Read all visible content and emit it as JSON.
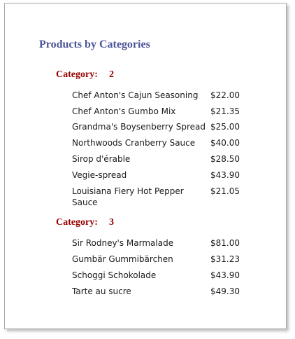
{
  "report": {
    "title": "Products by Categories",
    "groups": [
      {
        "category_label": "Category:",
        "category_value": "2",
        "products": [
          {
            "name": "Chef Anton's Cajun Seasoning",
            "price": "$22.00"
          },
          {
            "name": "Chef Anton's Gumbo Mix",
            "price": "$21.35"
          },
          {
            "name": "Grandma's Boysenberry Spread",
            "price": "$25.00"
          },
          {
            "name": "Northwoods Cranberry Sauce",
            "price": "$40.00"
          },
          {
            "name": "Sirop d'érable",
            "price": "$28.50"
          },
          {
            "name": "Vegie-spread",
            "price": "$43.90"
          },
          {
            "name": "Louisiana Fiery Hot Pepper Sauce",
            "price": "$21.05"
          }
        ]
      },
      {
        "category_label": "Category:",
        "category_value": "3",
        "products": [
          {
            "name": "Sir Rodney's Marmalade",
            "price": "$81.00"
          },
          {
            "name": "Gumbär Gummibärchen",
            "price": "$31.23"
          },
          {
            "name": "Schoggi Schokolade",
            "price": "$43.90"
          },
          {
            "name": "Tarte au sucre",
            "price": "$49.30"
          }
        ]
      }
    ]
  }
}
